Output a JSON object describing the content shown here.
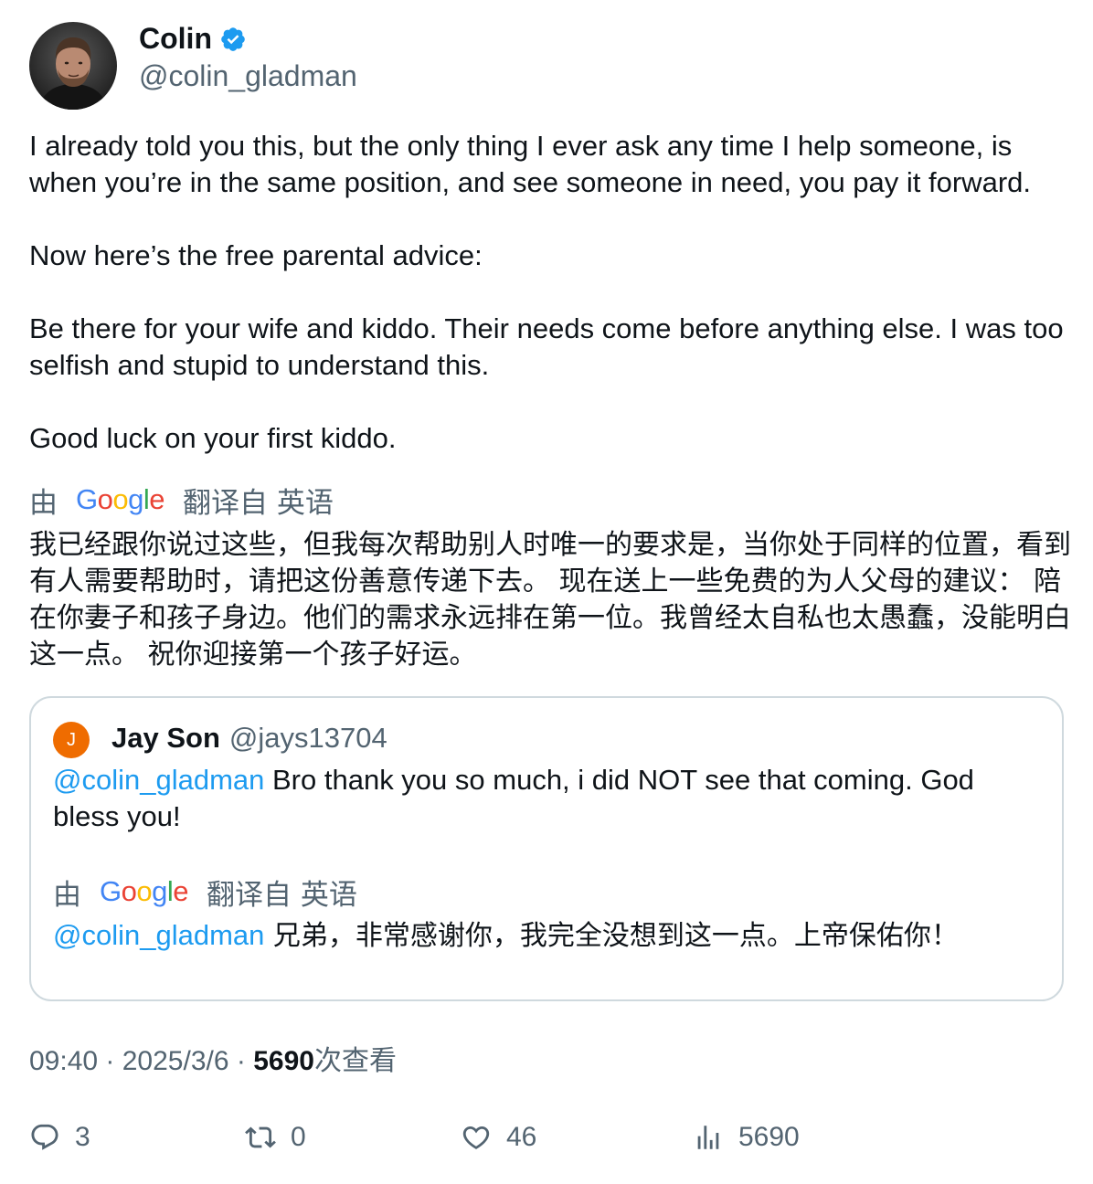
{
  "author": {
    "display_name": "Colin",
    "handle": "@colin_gladman"
  },
  "tweet": {
    "paragraphs": [
      "I already told you this, but the only thing I ever ask any time I help someone, is when you’re in the same position, and see someone in need, you pay it forward.",
      "Now here’s the free parental advice:",
      "Be there for your wife and kiddo. Their needs come before anything else. I was too selfish and stupid to understand this.",
      "Good luck on your first kiddo."
    ],
    "translation_prefix": "由",
    "translation_brand": "Google",
    "translation_suffix": "翻译自 英语",
    "translation": "我已经跟你说过这些，但我每次帮助别人时唯一的要求是，当你处于同样的位置，看到有人需要帮助时，请把这份善意传递下去。 现在送上一些免费的为人父母的建议： 陪在你妻子和孩子身边。他们的需求永远排在第一位。我曾经太自私也太愚蠢，没能明白这一点。 祝你迎接第一个孩子好运。"
  },
  "quoted": {
    "avatar_letter": "J",
    "display_name": "Jay Son",
    "handle": "@jays13704",
    "mention": "@colin_gladman",
    "text": " Bro thank you so much, i did NOT see that coming. God bless you!",
    "translation_prefix": "由",
    "translation_brand": "Google",
    "translation_suffix": "翻译自 英语",
    "translation_mention": "@colin_gladman",
    "translation": " 兄弟，非常感谢你，我完全没想到这一点。上帝保佑你！"
  },
  "meta": {
    "time": "09:40",
    "sep1": " · ",
    "date": "2025/3/6",
    "sep2": " · ",
    "views": "5690",
    "views_label": "次查看"
  },
  "actions": {
    "replies": "3",
    "retweets": "0",
    "likes": "46",
    "views": "5690"
  },
  "colors": {
    "accent": "#1d9bf0",
    "secondary_text": "#536471",
    "border": "#cfd9de",
    "quoted_avatar": "#ef6c00"
  },
  "icons": {
    "verified": "verified-badge-icon",
    "reply": "reply-icon",
    "retweet": "retweet-icon",
    "like": "heart-icon",
    "views": "analytics-icon"
  }
}
